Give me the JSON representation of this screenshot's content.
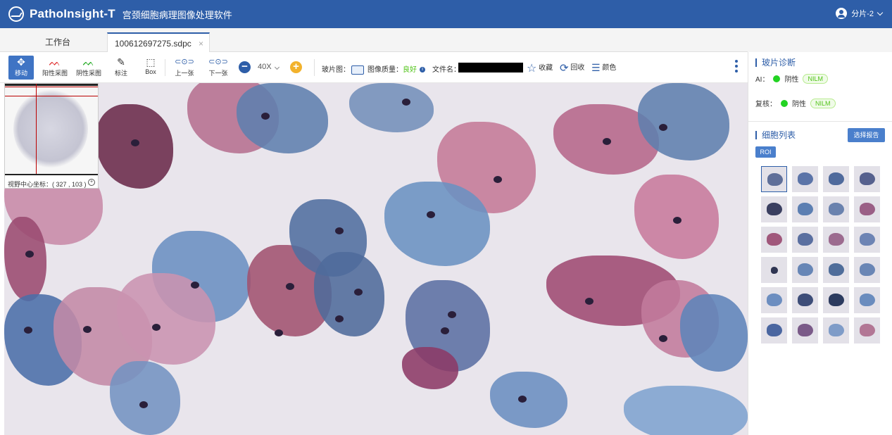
{
  "header": {
    "brand": "PathoInsight-T",
    "subtitle": "宫颈细胞病理图像处理软件",
    "user": "分片-2"
  },
  "tabs": [
    {
      "label": "工作台"
    },
    {
      "label": "100612697275.sdpc",
      "close": "×"
    }
  ],
  "toolbar": {
    "tools": [
      {
        "label": "移动",
        "icon": "move-icon"
      },
      {
        "label": "阳性采图",
        "icon": "positive-sample-icon"
      },
      {
        "label": "阴性采图",
        "icon": "negative-sample-icon"
      },
      {
        "label": "标注",
        "icon": "annotate-icon"
      },
      {
        "label": "Box",
        "icon": "box-select-icon"
      },
      {
        "label": "上一张",
        "icon": "prev-slide-icon"
      },
      {
        "label": "下一张",
        "icon": "next-slide-icon"
      }
    ],
    "zoom": "40X",
    "slide_label": "玻片图：",
    "quality_label": "图像质量：",
    "quality_value": "良好",
    "filename_label": "文件名：",
    "favorite_label": "收藏",
    "recycle_label": "回收",
    "color_label": "颜色"
  },
  "minimap": {
    "coord_text": "视野中心坐标：( 327 , 103 )"
  },
  "panel": {
    "diagnosis_title": "玻片诊断",
    "ai_label": "AI：",
    "ai_result": "阴性",
    "ai_badge": "NILM",
    "review_label": "复核：",
    "review_result": "阴性",
    "review_badge": "NILM",
    "cell_list_title": "细胞列表",
    "report_button": "选择报告",
    "roi_label": "ROI"
  },
  "colors": {
    "primary": "#2e5ea8",
    "good": "#52c41a",
    "status_dot": "#22d322",
    "zoom_plus": "#f2b22d"
  }
}
